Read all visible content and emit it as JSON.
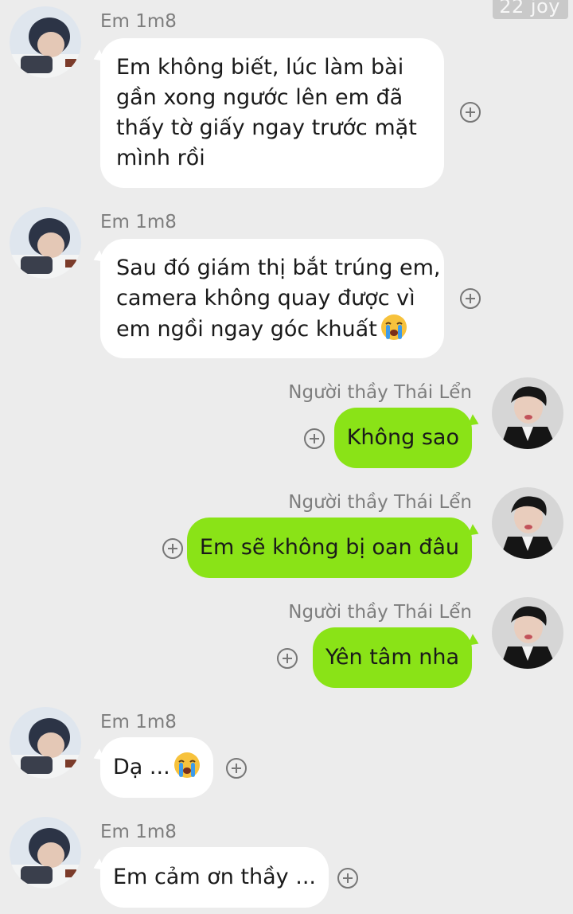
{
  "watermark": "22 joy",
  "messages": [
    {
      "sender": "Em 1m8",
      "lines": [
        "Em không biết, lúc làm bài",
        "gần xong ngước lên em đã",
        "thấy tờ giấy ngay trước mặt",
        "mình rồi"
      ]
    },
    {
      "sender": "Em 1m8",
      "lines": [
        "Sau đó giám thị bắt trúng em,",
        "camera không quay được vì",
        "em ngồi ngay góc khuất"
      ],
      "emoji": "crying-face"
    },
    {
      "sender": "Người thầy Thái Lển",
      "text": "Không sao"
    },
    {
      "sender": "Người thầy Thái Lển",
      "text": "Em sẽ không bị oan đâu"
    },
    {
      "sender": "Người thầy Thái Lển",
      "text": "Yên tâm nha"
    },
    {
      "sender": "Em 1m8",
      "text": "Dạ ...",
      "emoji": "crying-face"
    },
    {
      "sender": "Em 1m8",
      "text": "Em cảm ơn thầy ..."
    }
  ],
  "colors": {
    "background": "#ececec",
    "incoming_bubble": "#ffffff",
    "outgoing_bubble": "#8ae317"
  },
  "icons": {
    "reaction": "plus-circle-icon",
    "emoji": "crying-face-emoji"
  }
}
